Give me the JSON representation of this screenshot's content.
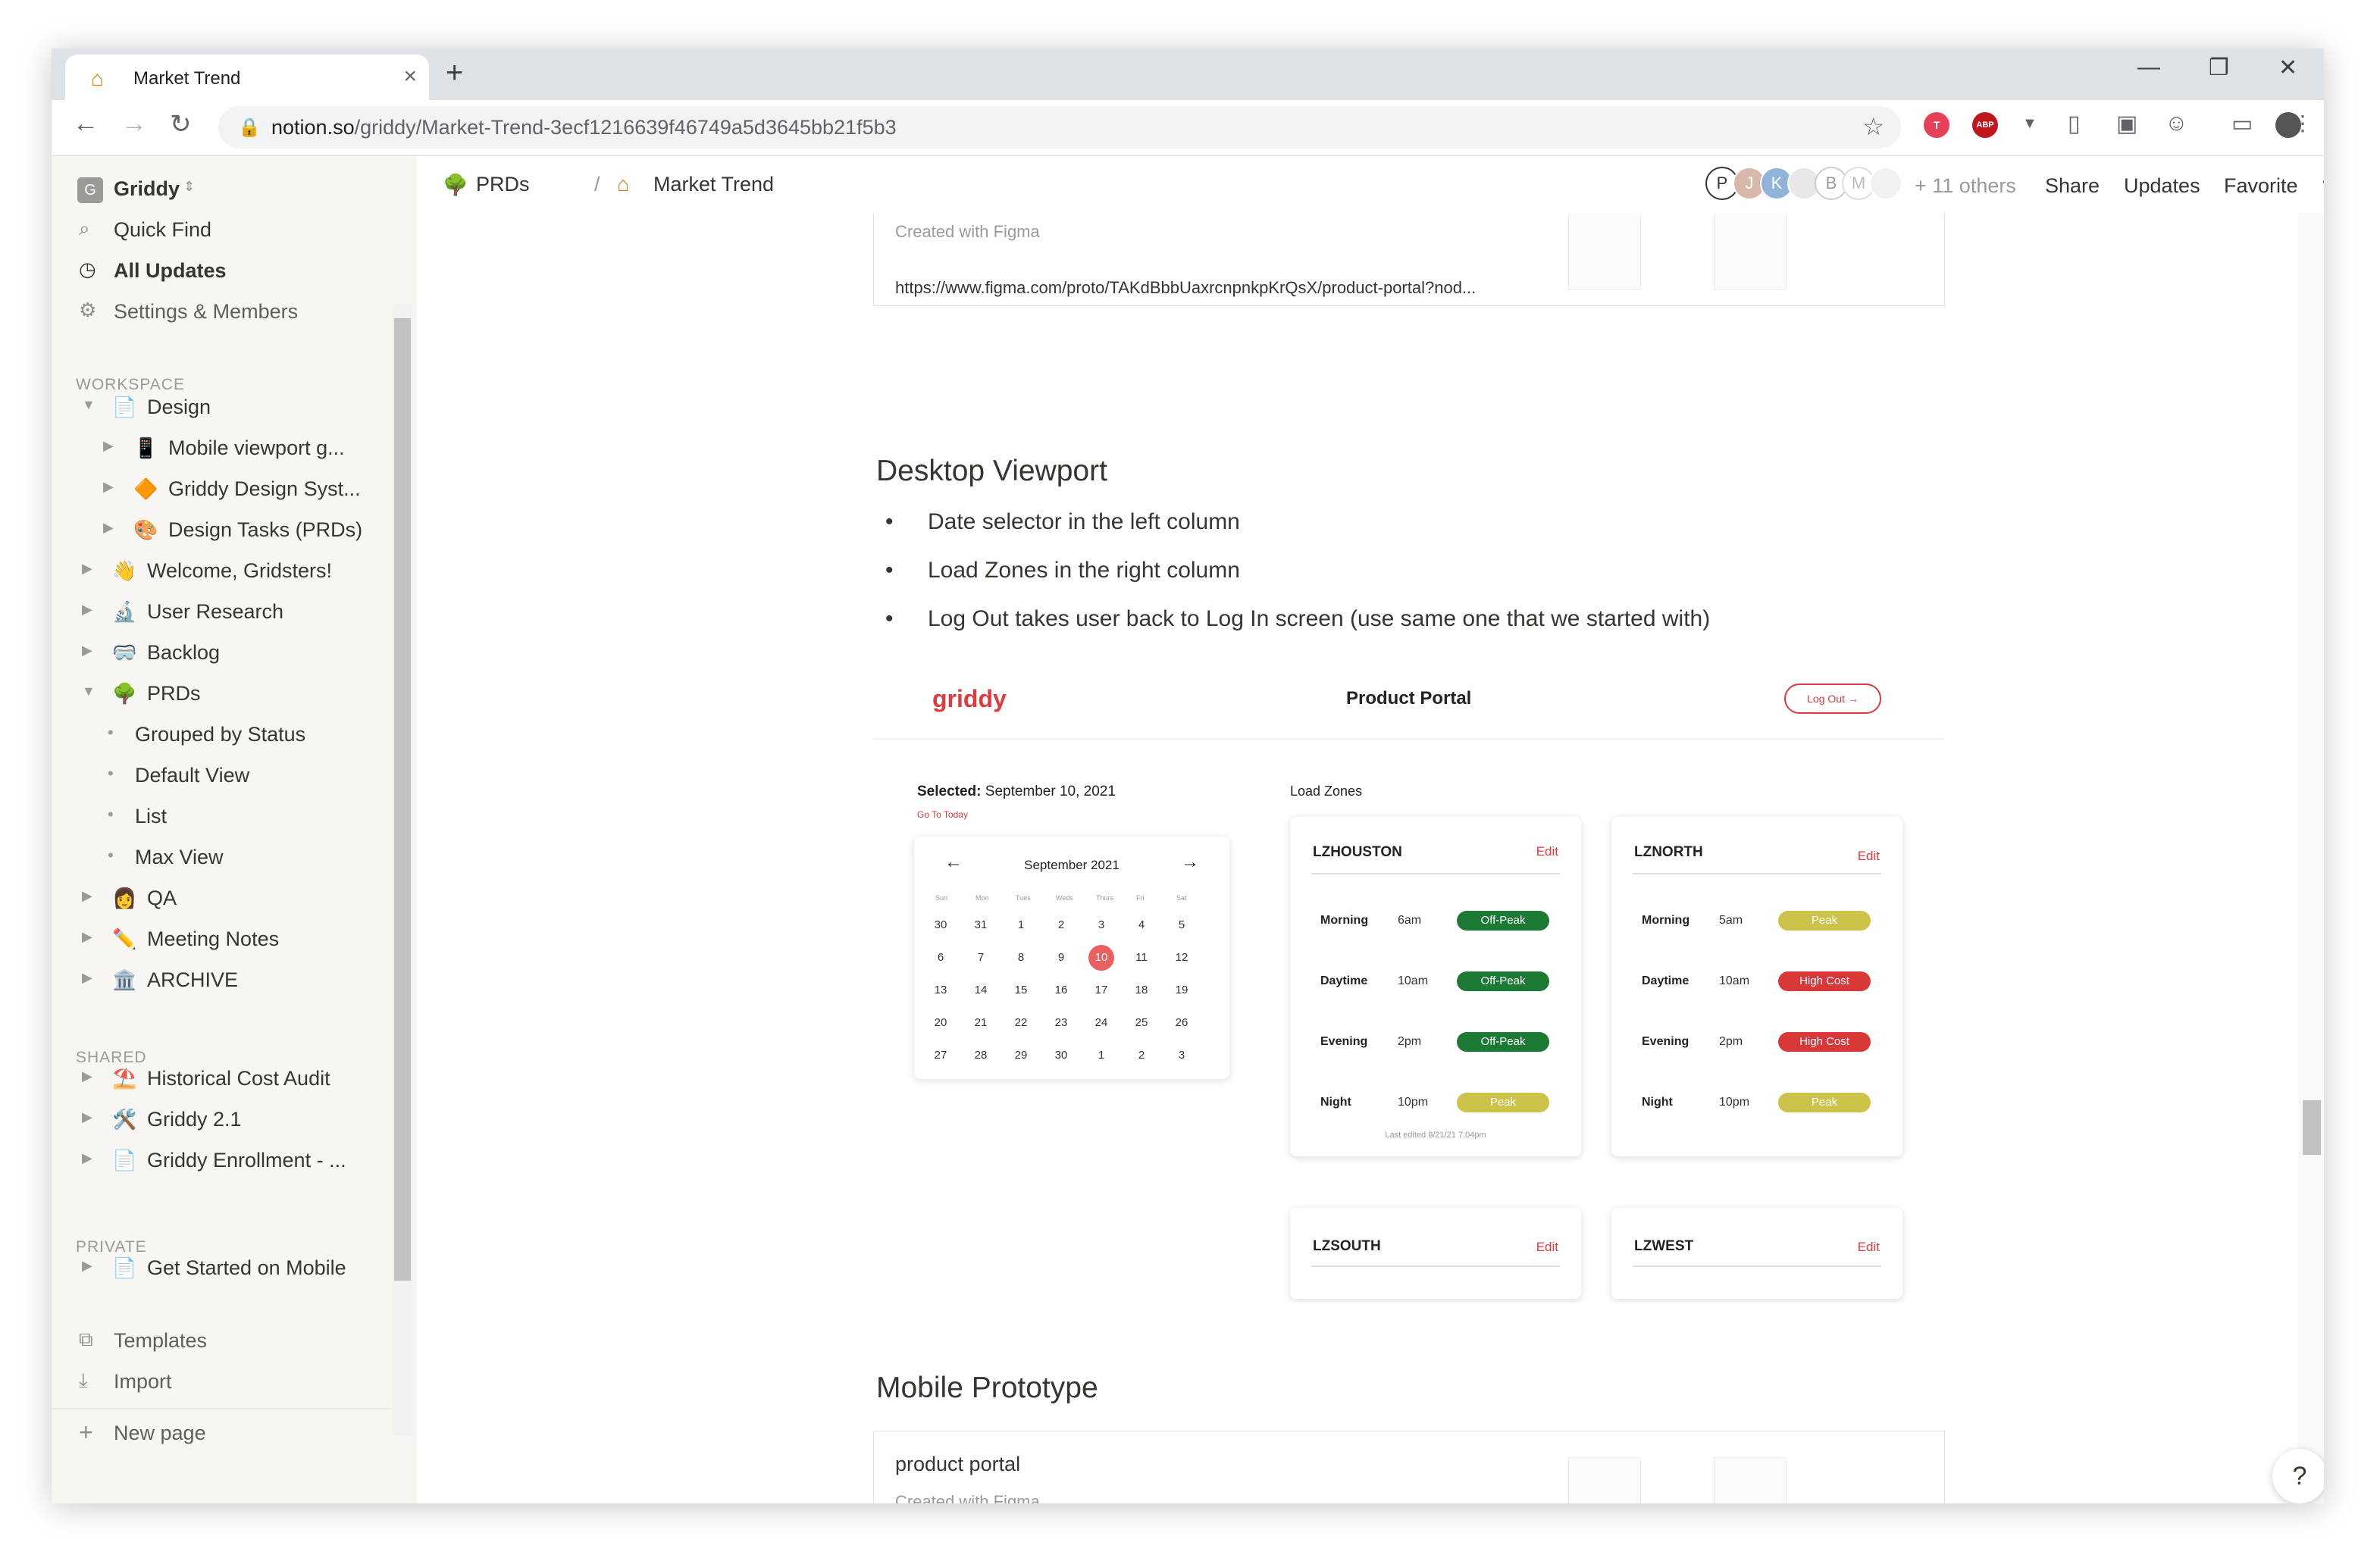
{
  "browser": {
    "tab_title": "Market Trend",
    "url_domain": "notion.so",
    "url_path": "/griddy/Market-Trend-3ecf1216639f46749a5d3645bb21f5b3",
    "ext_labels": [
      "T",
      "ABP"
    ]
  },
  "sidebar": {
    "workspace_name": "Griddy",
    "workspace_initial": "G",
    "top_items": [
      {
        "label": "Quick Find",
        "icon": "search-icon"
      },
      {
        "label": "All Updates",
        "icon": "clock-icon"
      },
      {
        "label": "Settings & Members",
        "icon": "gear-icon"
      }
    ],
    "sections": {
      "workspace": "WORKSPACE",
      "shared": "SHARED",
      "private": "PRIVATE"
    },
    "workspace_items": [
      {
        "label": "Design",
        "icon": "📄"
      },
      {
        "label": "Mobile viewport g...",
        "icon": "📱"
      },
      {
        "label": "Griddy Design Syst...",
        "icon": "🔶"
      },
      {
        "label": "Design Tasks (PRDs)",
        "icon": "🎨"
      },
      {
        "label": "Welcome, Gridsters!",
        "icon": "👋"
      },
      {
        "label": "User Research",
        "icon": "🔬"
      },
      {
        "label": "Backlog",
        "icon": "🥽"
      },
      {
        "label": "PRDs",
        "icon": "🌳"
      },
      {
        "label": "Grouped by Status",
        "icon": "•"
      },
      {
        "label": "Default View",
        "icon": "•"
      },
      {
        "label": "List",
        "icon": "•"
      },
      {
        "label": "Max View",
        "icon": "•"
      },
      {
        "label": "QA",
        "icon": "👩"
      },
      {
        "label": "Meeting Notes",
        "icon": "✏️"
      },
      {
        "label": "ARCHIVE",
        "icon": "🏛️"
      }
    ],
    "shared_items": [
      {
        "label": "Historical Cost Audit",
        "icon": "⛱️"
      },
      {
        "label": "Griddy 2.1",
        "icon": "🛠️"
      },
      {
        "label": "Griddy Enrollment - ...",
        "icon": "📄"
      }
    ],
    "private_items": [
      {
        "label": "Get Started on Mobile",
        "icon": "📄"
      }
    ],
    "bottom_items": [
      {
        "label": "Templates",
        "icon": "templates-icon"
      },
      {
        "label": "Import",
        "icon": "download-icon"
      },
      {
        "label": "New page",
        "icon": "plus-icon"
      }
    ]
  },
  "topbar": {
    "crumb_parent": "PRDs",
    "crumb_parent_icon": "🌳",
    "crumb_sep": "/",
    "crumb_current": "Market Trend",
    "avatars": [
      "P",
      "J",
      "K",
      "",
      "B",
      "M",
      ""
    ],
    "others": "+ 11 others",
    "share": "Share",
    "updates": "Updates",
    "favorite": "Favorite",
    "more": "•••"
  },
  "content": {
    "embed1": {
      "subtitle": "Created with Figma",
      "url": "https://www.figma.com/proto/TAKdBbbUaxrcnpnkpKrQsX/product-portal?nod..."
    },
    "heading_desktop": "Desktop Viewport",
    "bullets": [
      "Date selector in the left column",
      "Load Zones in the right column",
      "Log Out takes user back to Log In screen (use same one that we started with)"
    ],
    "heading_mobile": "Mobile Prototype",
    "embed2": {
      "title": "product portal",
      "subtitle": "Created with Figma"
    }
  },
  "figma": {
    "logo": "griddy",
    "title": "Product Portal",
    "logout": "Log Out →",
    "selected_label": "Selected:",
    "selected_date": "September 10, 2021",
    "go_today": "Go To Today",
    "load_zones": "Load Zones",
    "calendar": {
      "month": "September 2021",
      "weekdays": [
        "Sun",
        "Mon",
        "Tues",
        "Weds",
        "Thurs",
        "Fri",
        "Sat"
      ],
      "weeks": [
        [
          "30",
          "31",
          "1",
          "2",
          "3",
          "4",
          "5"
        ],
        [
          "6",
          "7",
          "8",
          "9",
          "10",
          "11",
          "12"
        ],
        [
          "13",
          "14",
          "15",
          "16",
          "17",
          "18",
          "19"
        ],
        [
          "20",
          "21",
          "22",
          "23",
          "24",
          "25",
          "26"
        ],
        [
          "27",
          "28",
          "29",
          "30",
          "1",
          "2",
          "3"
        ]
      ],
      "today": "10"
    },
    "zones": [
      {
        "name": "LZHOUSTON",
        "edit": "Edit",
        "rows": [
          {
            "label": "Morning",
            "time": "6am",
            "status": "Off-Peak"
          },
          {
            "label": "Daytime",
            "time": "10am",
            "status": "Off-Peak"
          },
          {
            "label": "Evening",
            "time": "2pm",
            "status": "Off-Peak"
          },
          {
            "label": "Night",
            "time": "10pm",
            "status": "Peak"
          }
        ],
        "last_edited": "Last edited 8/21/21 7:04pm"
      },
      {
        "name": "LZNORTH",
        "edit": "Edit",
        "rows": [
          {
            "label": "Morning",
            "time": "5am",
            "status": "Peak"
          },
          {
            "label": "Daytime",
            "time": "10am",
            "status": "High Cost"
          },
          {
            "label": "Evening",
            "time": "2pm",
            "status": "High Cost"
          },
          {
            "label": "Night",
            "time": "10pm",
            "status": "Peak"
          }
        ],
        "last_edited": ""
      }
    ],
    "zones_lower": [
      {
        "name": "LZSOUTH",
        "edit": "Edit"
      },
      {
        "name": "LZWEST",
        "edit": "Edit"
      }
    ]
  },
  "help": "?",
  "colors": {
    "brand": "#e0393e",
    "off_peak": "#1d7a35",
    "peak": "#cbc34a",
    "high_cost": "#d93838"
  }
}
